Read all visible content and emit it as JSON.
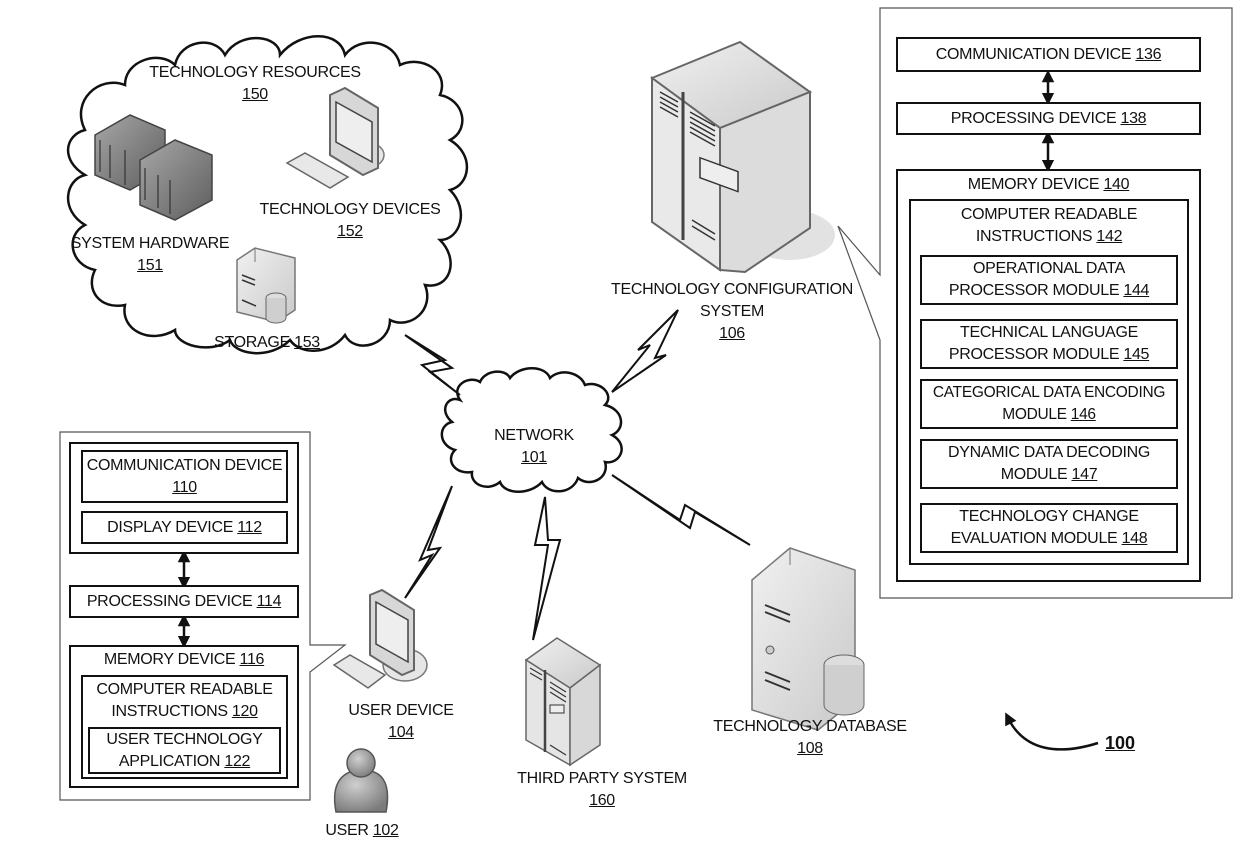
{
  "figure": {
    "ref": "100"
  },
  "resources_cloud": {
    "title": "TECHNOLOGY RESOURCES",
    "ref": "150",
    "items": [
      {
        "label": "SYSTEM HARDWARE",
        "ref": "151",
        "icon": "server-rack-icon"
      },
      {
        "label": "TECHNOLOGY DEVICES",
        "ref": "152",
        "icon": "desktop-computer-icon"
      },
      {
        "label": "STORAGE",
        "ref": "153",
        "icon": "storage-server-icon"
      }
    ]
  },
  "network": {
    "label": "NETWORK",
    "ref": "101"
  },
  "config_system": {
    "label_line1": "TECHNOLOGY CONFIGURATION",
    "label_line2": "SYSTEM",
    "ref": "106",
    "components": {
      "communication": {
        "label": "COMMUNICATION DEVICE",
        "ref": "136"
      },
      "processing": {
        "label": "PROCESSING DEVICE",
        "ref": "138"
      },
      "memory": {
        "label": "MEMORY DEVICE",
        "ref": "140"
      },
      "instructions": {
        "line1": "COMPUTER READABLE",
        "line2": "INSTRUCTIONS",
        "ref": "142"
      },
      "modules": [
        {
          "line1": "OPERATIONAL DATA",
          "line2": "PROCESSOR MODULE",
          "ref": "144"
        },
        {
          "line1": "TECHNICAL LANGUAGE",
          "line2": "PROCESSOR MODULE",
          "ref": "145"
        },
        {
          "line1": "CATEGORICAL DATA ENCODING",
          "line2": "MODULE",
          "ref": "146"
        },
        {
          "line1": "DYNAMIC DATA DECODING",
          "line2": "MODULE",
          "ref": "147"
        },
        {
          "line1": "TECHNOLOGY CHANGE",
          "line2": "EVALUATION MODULE",
          "ref": "148"
        }
      ]
    }
  },
  "user_device": {
    "label": "USER DEVICE",
    "ref": "104",
    "components": {
      "communication": {
        "label": "COMMUNICATION DEVICE",
        "ref": "110"
      },
      "display": {
        "label": "DISPLAY DEVICE",
        "ref": "112"
      },
      "processing": {
        "label": "PROCESSING DEVICE",
        "ref": "114"
      },
      "memory": {
        "label": "MEMORY DEVICE",
        "ref": "116"
      },
      "instructions": {
        "line1": "COMPUTER READABLE",
        "line2": "INSTRUCTIONS",
        "ref": "120"
      },
      "application": {
        "line1": "USER TECHNOLOGY",
        "line2": "APPLICATION",
        "ref": "122"
      }
    }
  },
  "user": {
    "label": "USER",
    "ref": "102"
  },
  "third_party": {
    "label": "THIRD PARTY SYSTEM",
    "ref": "160"
  },
  "database": {
    "label": "TECHNOLOGY DATABASE",
    "ref": "108"
  }
}
